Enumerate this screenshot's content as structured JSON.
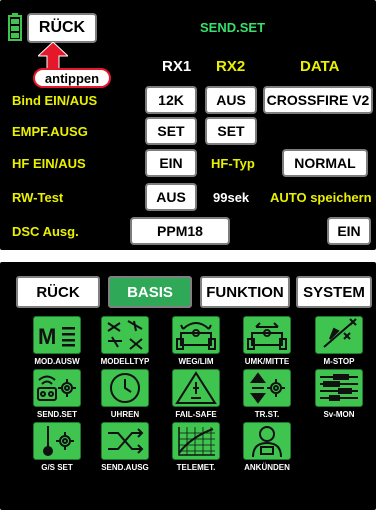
{
  "top_screen": {
    "back_button": "RÜCK",
    "title": "SEND.SET",
    "columns": {
      "rx1": "RX1",
      "rx2": "RX2",
      "data": "DATA"
    },
    "rows": {
      "bind": {
        "label": "Bind EIN/AUS",
        "rx1": "12K",
        "rx2": "AUS",
        "data": "CROSSFIRE V2"
      },
      "empf": {
        "label": "EMPF.AUSG",
        "rx1": "SET",
        "rx2": "SET"
      },
      "hf": {
        "label": "HF EIN/AUS",
        "rx1": "EIN",
        "hf_type_label": "HF-Typ",
        "hf_type_value": "NORMAL"
      },
      "rw": {
        "label": "RW-Test",
        "rx1": "AUS",
        "seconds": "99sek",
        "auto_save_label": "AUTO speichern"
      },
      "dsc": {
        "label": "DSC Ausg.",
        "value": "PPM18",
        "auto_save_value": "EIN"
      }
    },
    "annotation": "antippen"
  },
  "bottom_screen": {
    "tabs": [
      "RÜCK",
      "BASIS",
      "FUNKTION",
      "SYSTEM"
    ],
    "active_tab": "BASIS",
    "icons": [
      {
        "label": "MOD.AUSW",
        "icon": "model-select-icon"
      },
      {
        "label": "MODELLTYP",
        "icon": "model-type-icon"
      },
      {
        "label": "WEG/LIM",
        "icon": "servo-travel-icon"
      },
      {
        "label": "UMK/MITTE",
        "icon": "servo-reverse-icon"
      },
      {
        "label": "M-STOP",
        "icon": "motor-stop-icon"
      },
      {
        "label": "SEND.SET",
        "icon": "transmitter-settings-icon"
      },
      {
        "label": "UHREN",
        "icon": "clock-icon"
      },
      {
        "label": "FAIL-SAFE",
        "icon": "fail-safe-icon"
      },
      {
        "label": "TR.ST.",
        "icon": "trim-step-icon"
      },
      {
        "label": "Sv-MON",
        "icon": "servo-monitor-icon"
      },
      {
        "label": "G/S SET",
        "icon": "throttle-settings-icon"
      },
      {
        "label": "SEND.AUSG",
        "icon": "transmitter-output-icon"
      },
      {
        "label": "TELEMET.",
        "icon": "telemetry-icon"
      },
      {
        "label": "ANKÜNDEN",
        "icon": "announcement-icon"
      }
    ],
    "colors": {
      "tile": "#3ec44f",
      "active_tab": "#2fa858",
      "label_yellow": "#e9f000",
      "label_green": "#37e06a",
      "annotation": "#e5182b"
    }
  }
}
